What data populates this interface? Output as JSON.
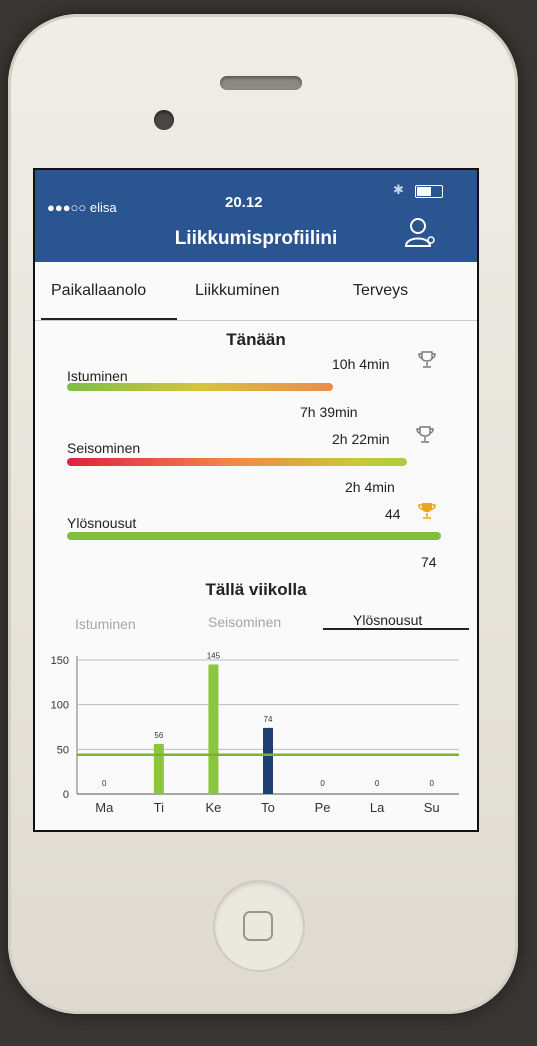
{
  "status": {
    "carrier": "●●●○○ elisa",
    "time": "20.12"
  },
  "header": {
    "title": "Liikkumisprofiilini"
  },
  "tabs": [
    "Paikallaanolo",
    "Liikkuminen",
    "Terveys"
  ],
  "today": {
    "title": "Tänään",
    "metrics": [
      {
        "label": "Istuminen",
        "value": "10h 4min",
        "target": "7h 39min",
        "progress": 0.85
      },
      {
        "label": "Seisominen",
        "value": "2h 22min",
        "target": "2h 4min",
        "progress": 1.0
      },
      {
        "label": "Ylösnousut",
        "value": "44",
        "target": "74",
        "progress": 1.0
      }
    ]
  },
  "week": {
    "title": "Tällä viikolla",
    "subtabs": [
      "Istuminen",
      "Seisominen",
      "Ylösnousut"
    ],
    "active_subtab": "Ylösnousut"
  },
  "colors": {
    "header": "#2a5591",
    "bar_green": "#8cc63f",
    "bar_today": "#1f3f73",
    "target_line": "#7ab32e"
  },
  "chart_data": {
    "type": "bar",
    "categories": [
      "Ma",
      "Ti",
      "Ke",
      "To",
      "Pe",
      "La",
      "Su"
    ],
    "values": [
      0,
      56,
      145,
      74,
      0,
      0,
      0
    ],
    "ylim": [
      0,
      150
    ],
    "yticks": [
      0,
      50,
      100,
      150
    ],
    "target": 44,
    "grid": true
  }
}
